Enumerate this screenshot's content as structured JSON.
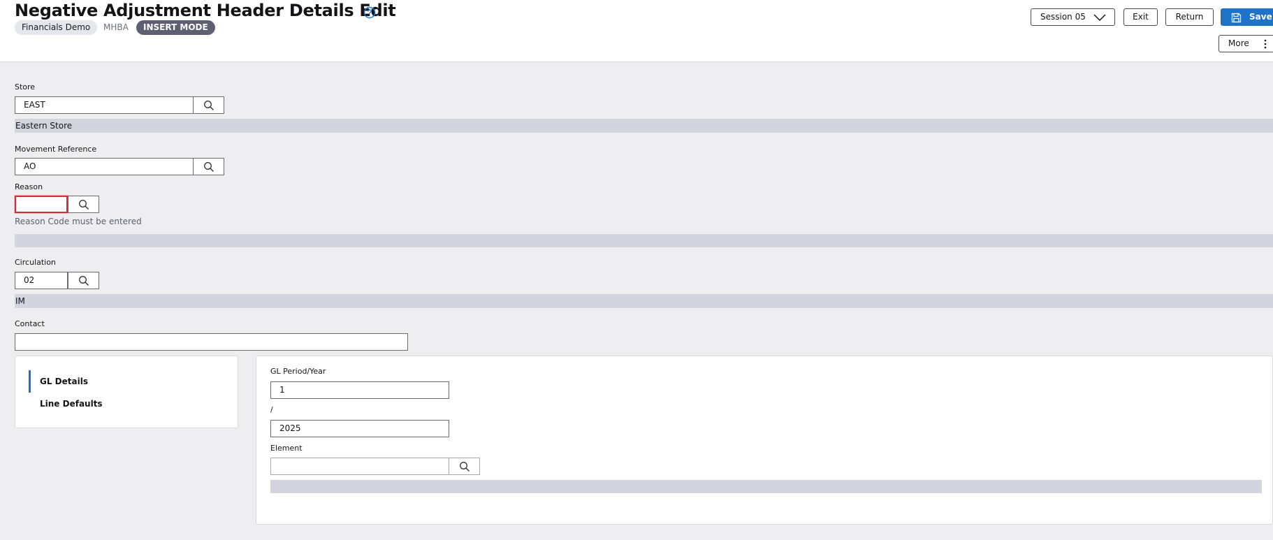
{
  "header": {
    "title": "Negative Adjustment Header Details Edit",
    "company_chip": "Financials Demo",
    "user_chip": "MHBA",
    "mode_chip": "INSERT MODE",
    "session_label": "Session 05",
    "exit_label": "Exit",
    "return_label": "Return",
    "save_label": "Save",
    "more_label": "More"
  },
  "form": {
    "store": {
      "label": "Store",
      "value": "EAST",
      "description": "Eastern Store"
    },
    "movement_reference": {
      "label": "Movement Reference",
      "value": "AO"
    },
    "reason": {
      "label": "Reason",
      "value": "",
      "error": "Reason Code must be entered",
      "description": ""
    },
    "circulation": {
      "label": "Circulation",
      "value": "02",
      "description": "IM"
    },
    "contact": {
      "label": "Contact",
      "value": ""
    }
  },
  "side_nav": {
    "items": [
      {
        "label": "GL Details",
        "active": true
      },
      {
        "label": "Line Defaults",
        "active": false
      }
    ]
  },
  "gl_details": {
    "period_year_label": "GL Period/Year",
    "period_value": "1",
    "separator": "/",
    "year_value": "2025",
    "element_label": "Element",
    "element_value": "",
    "element_description": ""
  },
  "colors": {
    "accent": "#1f73c6",
    "error": "#c8323c",
    "mode_chip": "#5e6072",
    "description_bar": "#d3d4de"
  },
  "icons": [
    "help-icon",
    "chevron-down-icon",
    "save-icon",
    "more-vertical-icon",
    "search-icon"
  ]
}
